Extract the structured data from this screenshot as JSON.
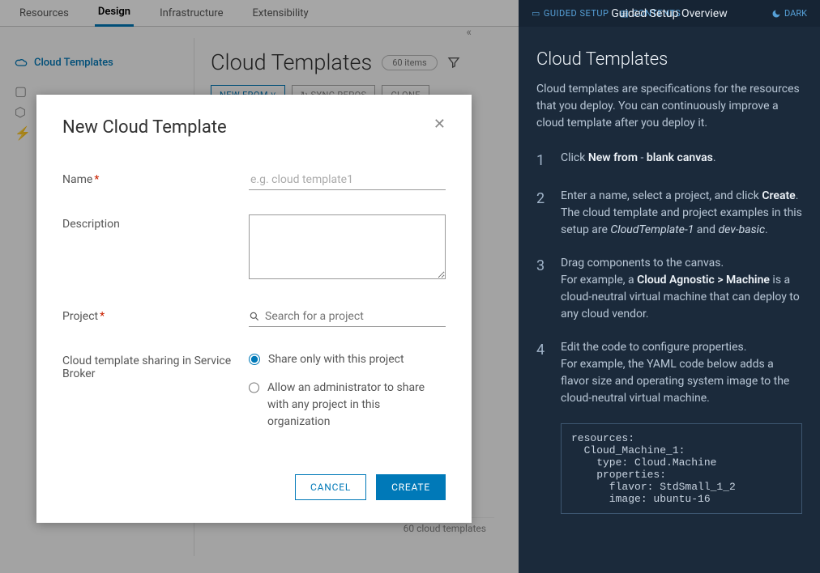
{
  "top_tabs": [
    "Resources",
    "Design",
    "Infrastructure",
    "Extensibility"
  ],
  "sidebar": {
    "item0": "Cloud Templates"
  },
  "page": {
    "title": "Cloud Templates",
    "count": "60 items",
    "toolbar": {
      "new_from": "NEW FROM",
      "sync": "SYNC REPOS",
      "clone": "CLONE"
    },
    "footer": "60 cloud templates"
  },
  "modal": {
    "title": "New Cloud Template",
    "labels": {
      "name": "Name",
      "desc": "Description",
      "project": "Project",
      "sharing": "Cloud template sharing in Service Broker"
    },
    "placeholders": {
      "name": "e.g. cloud template1",
      "project": "Search for a project"
    },
    "radios": {
      "share_only": "Share only with this project",
      "allow_admin": "Allow an administrator to share with any project in this organization"
    },
    "actions": {
      "cancel": "CANCEL",
      "create": "CREATE"
    }
  },
  "guide": {
    "top": {
      "setup": "GUIDED SETUP",
      "contents": "CONTENTS",
      "title": "Guided Setup Overview",
      "dark": "DARK"
    },
    "heading": "Cloud Templates",
    "intro": "Cloud templates are specifications for the resources that you deploy. You can continuously improve a cloud template after you deploy it.",
    "steps": {
      "1": {
        "pre": "Click ",
        "b1": "New from",
        "mid": " - ",
        "b2": "blank canvas",
        "post": "."
      },
      "2": {
        "pre": "Enter a name, select a project, and click ",
        "b1": "Create",
        "post1": ".",
        "line2a": "The cloud template and project examples in this setup are ",
        "i1": "CloudTemplate-1",
        "and": " and ",
        "i2": "dev-basic",
        "post2": "."
      },
      "3": {
        "line1": "Drag components to the canvas.",
        "pre": "For example, a ",
        "b1": "Cloud Agnostic > Machine",
        "post": " is a cloud-neutral virtual machine that can deploy to any cloud vendor."
      },
      "4": {
        "line1": "Edit the code to configure properties.",
        "line2": "For example, the YAML code below adds a flavor size and operating system image to the cloud-neutral virtual machine."
      }
    },
    "code": "resources:\n  Cloud_Machine_1:\n    type: Cloud.Machine\n    properties:\n      flavor: StdSmall_1_2\n      image: ubuntu-16"
  }
}
